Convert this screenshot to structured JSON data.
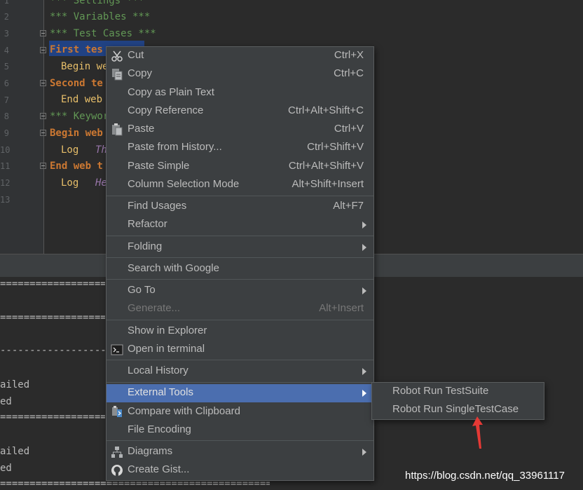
{
  "editor": {
    "line_numbers": [
      "1",
      "2",
      "3",
      "4",
      "5",
      "6",
      "7",
      "8",
      "9",
      "10",
      "11",
      "12",
      "13"
    ],
    "lines": [
      {
        "text": "*** Settings ***",
        "kind": "comment"
      },
      {
        "text": "*** Variables ***",
        "kind": "comment"
      },
      {
        "text": "*** Test Cases ***",
        "kind": "comment"
      },
      {
        "text": "First tes",
        "kind": "kw"
      },
      {
        "text": "Begin we",
        "kind": "key"
      },
      {
        "text": "Second te",
        "kind": "kw"
      },
      {
        "text": "End web",
        "kind": "key"
      },
      {
        "text": "*** Keywor",
        "kind": "comment"
      },
      {
        "text": "Begin web",
        "kind": "kw"
      },
      {
        "text": "Log",
        "arg": "Th",
        "kind": "key"
      },
      {
        "text": "End web t",
        "kind": "kw"
      },
      {
        "text": "Log",
        "arg": "He",
        "kind": "key"
      },
      {
        "text": "",
        "kind": "none"
      }
    ]
  },
  "console": {
    "lines": [
      "==========================",
      "==========================",
      "--------------------------",
      "ailed",
      "ed",
      "==========================",
      "ailed",
      "ed",
      "====================================================="
    ]
  },
  "menu": {
    "items": [
      {
        "label": "Cut",
        "shortcut": "Ctrl+X",
        "icon": "scissors-icon"
      },
      {
        "label": "Copy",
        "shortcut": "Ctrl+C",
        "icon": "copy-icon"
      },
      {
        "label": "Copy as Plain Text",
        "shortcut": ""
      },
      {
        "label": "Copy Reference",
        "shortcut": "Ctrl+Alt+Shift+C"
      },
      {
        "label": "Paste",
        "shortcut": "Ctrl+V",
        "icon": "paste-icon"
      },
      {
        "label": "Paste from History...",
        "shortcut": "Ctrl+Shift+V"
      },
      {
        "label": "Paste Simple",
        "shortcut": "Ctrl+Alt+Shift+V"
      },
      {
        "label": "Column Selection Mode",
        "shortcut": "Alt+Shift+Insert"
      },
      {
        "label": "Find Usages",
        "shortcut": "Alt+F7"
      },
      {
        "label": "Refactor",
        "submenu": true
      },
      {
        "label": "Folding",
        "submenu": true
      },
      {
        "label": "Search with Google",
        "shortcut": ""
      },
      {
        "label": "Go To",
        "submenu": true
      },
      {
        "label": "Generate...",
        "shortcut": "Alt+Insert",
        "disabled": true
      },
      {
        "label": "Show in Explorer",
        "shortcut": ""
      },
      {
        "label": "Open in terminal",
        "shortcut": "",
        "icon": "terminal-icon"
      },
      {
        "label": "Local History",
        "submenu": true
      },
      {
        "label": "External Tools",
        "submenu": true,
        "highlighted": true
      },
      {
        "label": "Compare with Clipboard",
        "shortcut": "",
        "icon": "compare-icon"
      },
      {
        "label": "File Encoding",
        "shortcut": ""
      },
      {
        "label": "Diagrams",
        "submenu": true,
        "icon": "diagram-icon"
      },
      {
        "label": "Create Gist...",
        "shortcut": "",
        "icon": "github-icon"
      }
    ]
  },
  "submenu": {
    "items": [
      {
        "label": "Robot Run TestSuite"
      },
      {
        "label": "Robot Run SingleTestCase"
      }
    ]
  },
  "watermark": "https://blog.csdn.net/qq_33961117",
  "colors": {
    "highlight": "#4b6eaf",
    "menu_bg": "#3c3f41",
    "editor_bg": "#2b2b2b",
    "arrow": "#e53935"
  }
}
